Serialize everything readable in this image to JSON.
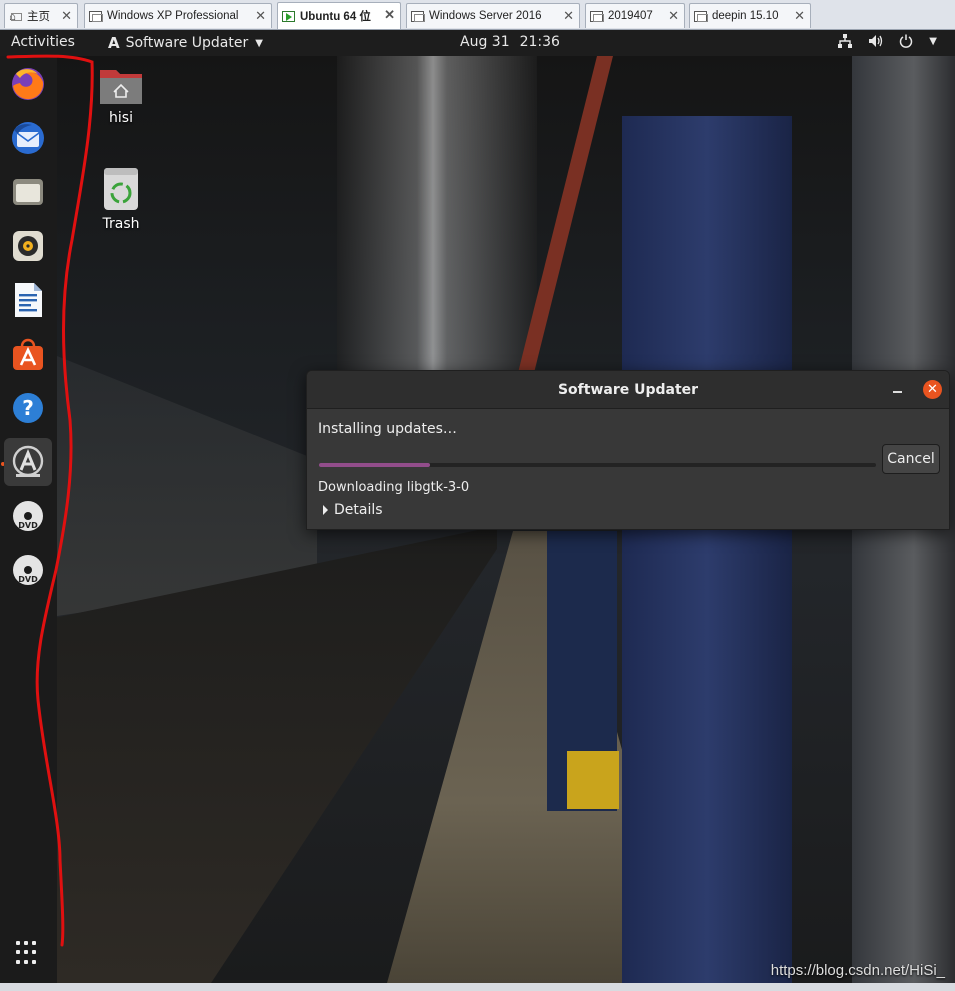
{
  "vm_tabs": [
    {
      "label": "主页",
      "active": false
    },
    {
      "label": "Windows XP Professional",
      "active": false
    },
    {
      "label": "Ubuntu 64 位",
      "active": true
    },
    {
      "label": "Windows Server 2016",
      "active": false
    },
    {
      "label": "2019407",
      "active": false
    },
    {
      "label": "deepin 15.10",
      "active": false
    }
  ],
  "topbar": {
    "activities": "Activities",
    "app_name": "Software Updater",
    "date": "Aug 31",
    "time": "21:36"
  },
  "dock": {
    "items": [
      "firefox-icon",
      "thunderbird-icon",
      "files-icon",
      "rhythmbox-icon",
      "writer-icon",
      "software-center-icon",
      "help-icon",
      "software-updater-icon",
      "dvd-icon",
      "dvd-icon"
    ],
    "active_index": 7
  },
  "desktop": {
    "icons": [
      {
        "label": "hisi",
        "icon": "home-folder-icon"
      },
      {
        "label": "Trash",
        "icon": "trash-icon"
      }
    ]
  },
  "dialog": {
    "title": "Software Updater",
    "status": "Installing updates…",
    "progress_percent": 20,
    "cancel_label": "Cancel",
    "sub_status": "Downloading libgtk-3-0",
    "details_label": "Details"
  },
  "watermark": "https://blog.csdn.net/HiSi_",
  "colors": {
    "ubuntu_orange": "#e95420",
    "progress": "#924d8b",
    "annotation_red": "#e01010"
  }
}
